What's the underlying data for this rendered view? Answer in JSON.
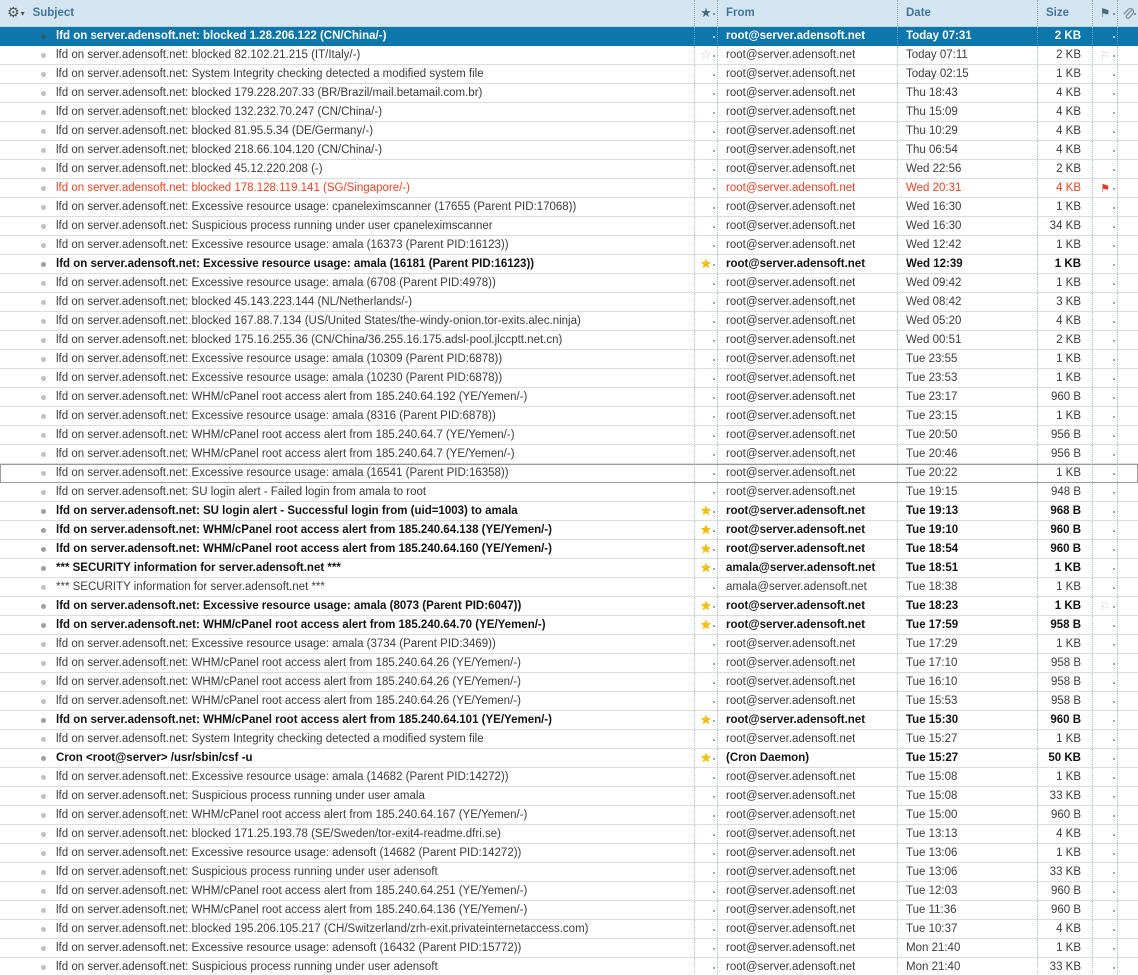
{
  "header": {
    "subject": "Subject",
    "from": "From",
    "date": "Date",
    "size": "Size"
  },
  "icons": {
    "gear": "⚙",
    "caret": "▾",
    "star": "★",
    "star_outline": "☆",
    "flag": "⚑",
    "flag_outline": "⚐",
    "attachment": "paperclip"
  },
  "colors": {
    "selected_row": "#0d76ab",
    "alert_text": "#fe3f20",
    "star_gold": "#f2bf0f",
    "flag_red": "#e63323",
    "header_bg": "#d4e6f1",
    "header_text": "#41759b"
  },
  "messages": [
    {
      "subject": "lfd on server.adensoft.net: blocked 1.28.206.122 (CN/China/-)",
      "from": "root@server.adensoft.net",
      "date": "Today 07:31",
      "size": "2 KB",
      "state": "selected",
      "star": "none",
      "flag": "none"
    },
    {
      "subject": "lfd on server.adensoft.net: blocked 82.102.21.215 (IT/Italy/-)",
      "from": "root@server.adensoft.net",
      "date": "Today 07:11",
      "size": "2 KB",
      "state": "read",
      "star": "outline",
      "flag": "outline"
    },
    {
      "subject": "lfd on server.adensoft.net: System Integrity checking detected a modified system file",
      "from": "root@server.adensoft.net",
      "date": "Today 02:15",
      "size": "1 KB",
      "state": "read",
      "star": "none",
      "flag": "none"
    },
    {
      "subject": "lfd on server.adensoft.net: blocked 179.228.207.33 (BR/Brazil/mail.betamail.com.br)",
      "from": "root@server.adensoft.net",
      "date": "Thu 18:43",
      "size": "4 KB",
      "state": "read",
      "star": "none",
      "flag": "none"
    },
    {
      "subject": "lfd on server.adensoft.net: blocked 132.232.70.247 (CN/China/-)",
      "from": "root@server.adensoft.net",
      "date": "Thu 15:09",
      "size": "4 KB",
      "state": "read",
      "star": "none",
      "flag": "none"
    },
    {
      "subject": "lfd on server.adensoft.net: blocked 81.95.5.34 (DE/Germany/-)",
      "from": "root@server.adensoft.net",
      "date": "Thu 10:29",
      "size": "4 KB",
      "state": "read",
      "star": "none",
      "flag": "none"
    },
    {
      "subject": "lfd on server.adensoft.net: blocked 218.66.104.120 (CN/China/-)",
      "from": "root@server.adensoft.net",
      "date": "Thu 06:54",
      "size": "4 KB",
      "state": "read",
      "star": "none",
      "flag": "none"
    },
    {
      "subject": "lfd on server.adensoft.net: blocked 45.12.220.208 (-)",
      "from": "root@server.adensoft.net",
      "date": "Wed 22:56",
      "size": "2 KB",
      "state": "read",
      "star": "none",
      "flag": "none"
    },
    {
      "subject": "lfd on server.adensoft.net: blocked 178.128.119.141 (SG/Singapore/-)",
      "from": "root@server.adensoft.net",
      "date": "Wed 20:31",
      "size": "4 KB",
      "state": "alert",
      "star": "none",
      "flag": "red"
    },
    {
      "subject": "lfd on server.adensoft.net: Excessive resource usage: cpaneleximscanner (17655 (Parent PID:17068))",
      "from": "root@server.adensoft.net",
      "date": "Wed 16:30",
      "size": "1 KB",
      "state": "read",
      "star": "none",
      "flag": "none"
    },
    {
      "subject": "lfd on server.adensoft.net: Suspicious process running under user cpaneleximscanner",
      "from": "root@server.adensoft.net",
      "date": "Wed 16:30",
      "size": "34 KB",
      "state": "read",
      "star": "none",
      "flag": "none"
    },
    {
      "subject": "lfd on server.adensoft.net: Excessive resource usage: amala (16373 (Parent PID:16123))",
      "from": "root@server.adensoft.net",
      "date": "Wed 12:42",
      "size": "1 KB",
      "state": "read",
      "star": "none",
      "flag": "none"
    },
    {
      "subject": "lfd on server.adensoft.net: Excessive resource usage: amala (16181 (Parent PID:16123))",
      "from": "root@server.adensoft.net",
      "date": "Wed 12:39",
      "size": "1 KB",
      "state": "unread",
      "star": "starred",
      "flag": "none"
    },
    {
      "subject": "lfd on server.adensoft.net: Excessive resource usage: amala (6708 (Parent PID:4978))",
      "from": "root@server.adensoft.net",
      "date": "Wed 09:42",
      "size": "1 KB",
      "state": "read",
      "star": "none",
      "flag": "none"
    },
    {
      "subject": "lfd on server.adensoft.net: blocked 45.143.223.144 (NL/Netherlands/-)",
      "from": "root@server.adensoft.net",
      "date": "Wed 08:42",
      "size": "3 KB",
      "state": "read",
      "star": "none",
      "flag": "none"
    },
    {
      "subject": "lfd on server.adensoft.net: blocked 167.88.7.134 (US/United States/the-windy-onion.tor-exits.alec.ninja)",
      "from": "root@server.adensoft.net",
      "date": "Wed 05:20",
      "size": "4 KB",
      "state": "read",
      "star": "none",
      "flag": "none"
    },
    {
      "subject": "lfd on server.adensoft.net: blocked 175.16.255.36 (CN/China/36.255.16.175.adsl-pool.jlccptt.net.cn)",
      "from": "root@server.adensoft.net",
      "date": "Wed 00:51",
      "size": "2 KB",
      "state": "read",
      "star": "none",
      "flag": "none"
    },
    {
      "subject": "lfd on server.adensoft.net: Excessive resource usage: amala (10309 (Parent PID:6878))",
      "from": "root@server.adensoft.net",
      "date": "Tue 23:55",
      "size": "1 KB",
      "state": "read",
      "star": "none",
      "flag": "none"
    },
    {
      "subject": "lfd on server.adensoft.net: Excessive resource usage: amala (10230 (Parent PID:6878))",
      "from": "root@server.adensoft.net",
      "date": "Tue 23:53",
      "size": "1 KB",
      "state": "read",
      "star": "none",
      "flag": "none"
    },
    {
      "subject": "lfd on server.adensoft.net: WHM/cPanel root access alert from 185.240.64.192 (YE/Yemen/-)",
      "from": "root@server.adensoft.net",
      "date": "Tue 23:17",
      "size": "960 B",
      "state": "read",
      "star": "none",
      "flag": "none"
    },
    {
      "subject": "lfd on server.adensoft.net: Excessive resource usage: amala (8316 (Parent PID:6878))",
      "from": "root@server.adensoft.net",
      "date": "Tue 23:15",
      "size": "1 KB",
      "state": "read",
      "star": "none",
      "flag": "none"
    },
    {
      "subject": "lfd on server.adensoft.net: WHM/cPanel root access alert from 185.240.64.7 (YE/Yemen/-)",
      "from": "root@server.adensoft.net",
      "date": "Tue 20:50",
      "size": "956 B",
      "state": "read",
      "star": "none",
      "flag": "none"
    },
    {
      "subject": "lfd on server.adensoft.net: WHM/cPanel root access alert from 185.240.64.7 (YE/Yemen/-)",
      "from": "root@server.adensoft.net",
      "date": "Tue 20:46",
      "size": "956 B",
      "state": "read",
      "star": "none",
      "flag": "none"
    },
    {
      "subject": "lfd on server.adensoft.net: Excessive resource usage: amala (16541 (Parent PID:16358))",
      "from": "root@server.adensoft.net",
      "date": "Tue 20:22",
      "size": "1 KB",
      "state": "focused",
      "star": "none",
      "flag": "none"
    },
    {
      "subject": "lfd on server.adensoft.net: SU login alert - Failed login from amala to root",
      "from": "root@server.adensoft.net",
      "date": "Tue 19:15",
      "size": "948 B",
      "state": "read",
      "star": "none",
      "flag": "none"
    },
    {
      "subject": "lfd on server.adensoft.net: SU login alert - Successful login from (uid=1003) to amala",
      "from": "root@server.adensoft.net",
      "date": "Tue 19:13",
      "size": "968 B",
      "state": "unread",
      "star": "starred",
      "flag": "none"
    },
    {
      "subject": "lfd on server.adensoft.net: WHM/cPanel root access alert from 185.240.64.138 (YE/Yemen/-)",
      "from": "root@server.adensoft.net",
      "date": "Tue 19:10",
      "size": "960 B",
      "state": "unread",
      "star": "starred",
      "flag": "none"
    },
    {
      "subject": "lfd on server.adensoft.net: WHM/cPanel root access alert from 185.240.64.160 (YE/Yemen/-)",
      "from": "root@server.adensoft.net",
      "date": "Tue 18:54",
      "size": "960 B",
      "state": "unread",
      "star": "starred",
      "flag": "none"
    },
    {
      "subject": "*** SECURITY information for server.adensoft.net ***",
      "from": "amala@server.adensoft.net",
      "date": "Tue 18:51",
      "size": "1 KB",
      "state": "unread",
      "star": "starred",
      "flag": "none"
    },
    {
      "subject": "*** SECURITY information for server.adensoft.net ***",
      "from": "amala@server.adensoft.net",
      "date": "Tue 18:38",
      "size": "1 KB",
      "state": "read",
      "star": "none",
      "flag": "none"
    },
    {
      "subject": "lfd on server.adensoft.net: Excessive resource usage: amala (8073 (Parent PID:6047))",
      "from": "root@server.adensoft.net",
      "date": "Tue 18:23",
      "size": "1 KB",
      "state": "unread",
      "star": "starred",
      "flag": "outline"
    },
    {
      "subject": "lfd on server.adensoft.net: WHM/cPanel root access alert from 185.240.64.70 (YE/Yemen/-)",
      "from": "root@server.adensoft.net",
      "date": "Tue 17:59",
      "size": "958 B",
      "state": "unread",
      "star": "starred",
      "flag": "none"
    },
    {
      "subject": "lfd on server.adensoft.net: Excessive resource usage: amala (3734 (Parent PID:3469))",
      "from": "root@server.adensoft.net",
      "date": "Tue 17:29",
      "size": "1 KB",
      "state": "read",
      "star": "none",
      "flag": "none"
    },
    {
      "subject": "lfd on server.adensoft.net: WHM/cPanel root access alert from 185.240.64.26 (YE/Yemen/-)",
      "from": "root@server.adensoft.net",
      "date": "Tue 17:10",
      "size": "958 B",
      "state": "read",
      "star": "none",
      "flag": "none"
    },
    {
      "subject": "lfd on server.adensoft.net: WHM/cPanel root access alert from 185.240.64.26 (YE/Yemen/-)",
      "from": "root@server.adensoft.net",
      "date": "Tue 16:10",
      "size": "958 B",
      "state": "read",
      "star": "none",
      "flag": "none"
    },
    {
      "subject": "lfd on server.adensoft.net: WHM/cPanel root access alert from 185.240.64.26 (YE/Yemen/-)",
      "from": "root@server.adensoft.net",
      "date": "Tue 15:53",
      "size": "958 B",
      "state": "read",
      "star": "none",
      "flag": "none"
    },
    {
      "subject": "lfd on server.adensoft.net: WHM/cPanel root access alert from 185.240.64.101 (YE/Yemen/-)",
      "from": "root@server.adensoft.net",
      "date": "Tue 15:30",
      "size": "960 B",
      "state": "unread",
      "star": "starred",
      "flag": "none"
    },
    {
      "subject": "lfd on server.adensoft.net: System Integrity checking detected a modified system file",
      "from": "root@server.adensoft.net",
      "date": "Tue 15:27",
      "size": "1 KB",
      "state": "read",
      "star": "none",
      "flag": "none"
    },
    {
      "subject": "Cron <root@server> /usr/sbin/csf -u",
      "from": "(Cron Daemon)",
      "date": "Tue 15:27",
      "size": "50 KB",
      "state": "unread",
      "star": "starred",
      "flag": "none"
    },
    {
      "subject": "lfd on server.adensoft.net: Excessive resource usage: amala (14682 (Parent PID:14272))",
      "from": "root@server.adensoft.net",
      "date": "Tue 15:08",
      "size": "1 KB",
      "state": "read",
      "star": "none",
      "flag": "none"
    },
    {
      "subject": "lfd on server.adensoft.net: Suspicious process running under user amala",
      "from": "root@server.adensoft.net",
      "date": "Tue 15:08",
      "size": "33 KB",
      "state": "read",
      "star": "none",
      "flag": "none"
    },
    {
      "subject": "lfd on server.adensoft.net: WHM/cPanel root access alert from 185.240.64.167 (YE/Yemen/-)",
      "from": "root@server.adensoft.net",
      "date": "Tue 15:00",
      "size": "960 B",
      "state": "read",
      "star": "none",
      "flag": "none"
    },
    {
      "subject": "lfd on server.adensoft.net: blocked 171.25.193.78 (SE/Sweden/tor-exit4-readme.dfri.se)",
      "from": "root@server.adensoft.net",
      "date": "Tue 13:13",
      "size": "4 KB",
      "state": "read",
      "star": "none",
      "flag": "none"
    },
    {
      "subject": "lfd on server.adensoft.net: Excessive resource usage: adensoft (14682 (Parent PID:14272))",
      "from": "root@server.adensoft.net",
      "date": "Tue 13:06",
      "size": "1 KB",
      "state": "read",
      "star": "none",
      "flag": "none"
    },
    {
      "subject": "lfd on server.adensoft.net: Suspicious process running under user adensoft",
      "from": "root@server.adensoft.net",
      "date": "Tue 13:06",
      "size": "33 KB",
      "state": "read",
      "star": "none",
      "flag": "none"
    },
    {
      "subject": "lfd on server.adensoft.net: WHM/cPanel root access alert from 185.240.64.251 (YE/Yemen/-)",
      "from": "root@server.adensoft.net",
      "date": "Tue 12:03",
      "size": "960 B",
      "state": "read",
      "star": "none",
      "flag": "none"
    },
    {
      "subject": "lfd on server.adensoft.net: WHM/cPanel root access alert from 185.240.64.136 (YE/Yemen/-)",
      "from": "root@server.adensoft.net",
      "date": "Tue 11:36",
      "size": "960 B",
      "state": "read",
      "star": "none",
      "flag": "none"
    },
    {
      "subject": "lfd on server.adensoft.net: blocked 195.206.105.217 (CH/Switzerland/zrh-exit.privateinternetaccess.com)",
      "from": "root@server.adensoft.net",
      "date": "Tue 10:37",
      "size": "4 KB",
      "state": "read",
      "star": "none",
      "flag": "none"
    },
    {
      "subject": "lfd on server.adensoft.net: Excessive resource usage: adensoft (16432 (Parent PID:15772))",
      "from": "root@server.adensoft.net",
      "date": "Mon 21:40",
      "size": "1 KB",
      "state": "read",
      "star": "none",
      "flag": "none"
    },
    {
      "subject": "lfd on server.adensoft.net: Suspicious process running under user adensoft",
      "from": "root@server.adensoft.net",
      "date": "Mon 21:40",
      "size": "33 KB",
      "state": "read",
      "star": "none",
      "flag": "none"
    }
  ]
}
